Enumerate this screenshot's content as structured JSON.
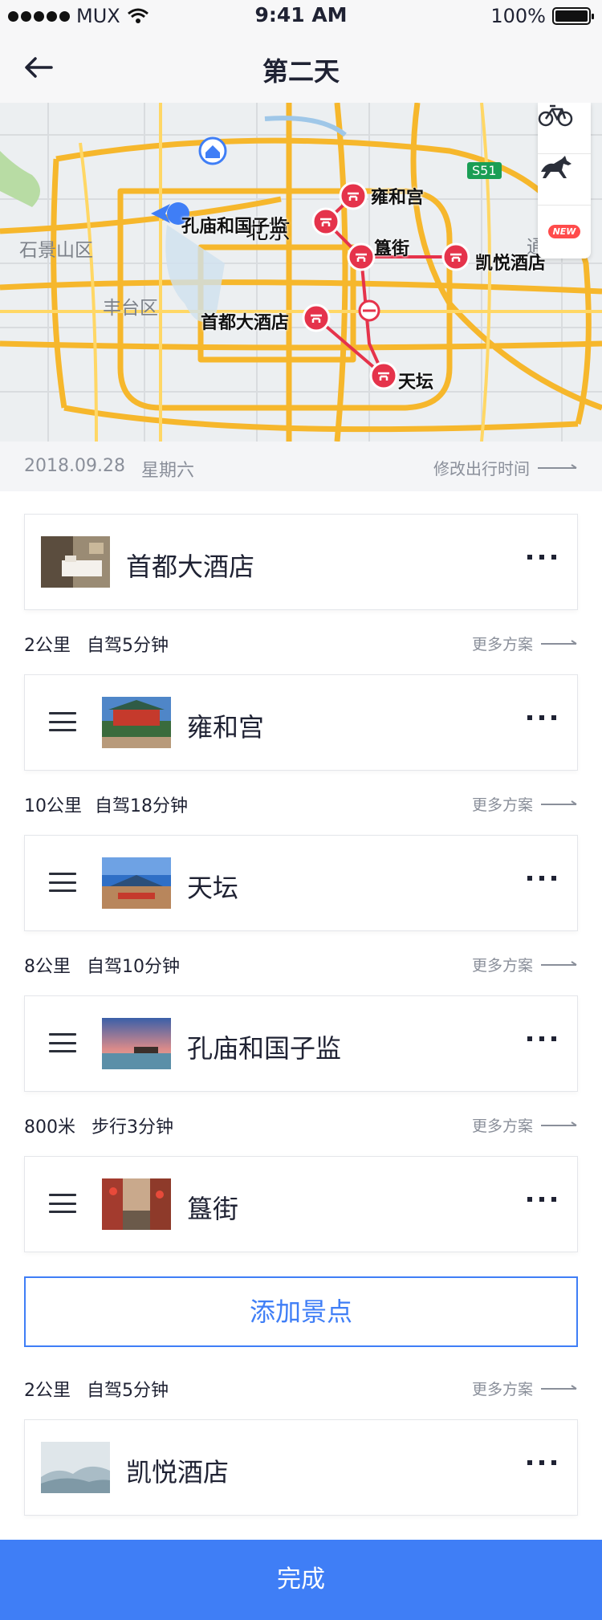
{
  "status_bar": {
    "carrier": "MUX",
    "time": "9:41 AM",
    "battery": "100%"
  },
  "nav": {
    "title": "第二天"
  },
  "map": {
    "district_labels": [
      "石景山区",
      "丰台区",
      "通州区"
    ],
    "city": "北京",
    "highway": "S51",
    "pois": [
      "孔庙和国子监",
      "雍和宫",
      "簋街",
      "凯悦酒店",
      "首都大酒店",
      "天坛"
    ],
    "mode_new_badge": "NEW",
    "route_color": "#e5334b",
    "road_color": "#f6b72c"
  },
  "date_row": {
    "date": "2018.09.28",
    "weekday": "星期六",
    "change_label": "修改出行时间"
  },
  "items": [
    {
      "name": "首都大酒店",
      "draggable": false
    },
    {
      "name": "雍和宫",
      "draggable": true
    },
    {
      "name": "天坛",
      "draggable": true
    },
    {
      "name": "孔庙和国子监",
      "draggable": true
    },
    {
      "name": "簋街",
      "draggable": true
    },
    {
      "name": "凯悦酒店",
      "draggable": false
    }
  ],
  "routes": [
    {
      "distance": "2公里",
      "mode": "自驾5分钟",
      "more": "更多方案"
    },
    {
      "distance": "10公里",
      "mode": "自驾18分钟",
      "more": "更多方案"
    },
    {
      "distance": "8公里",
      "mode": "自驾10分钟",
      "more": "更多方案"
    },
    {
      "distance": "800米",
      "mode": "步行3分钟",
      "more": "更多方案"
    },
    {
      "distance": "2公里",
      "mode": "自驾5分钟",
      "more": "更多方案"
    }
  ],
  "add_spot_label": "添加景点",
  "done_label": "完成",
  "accent_color": "#3f7ef6"
}
